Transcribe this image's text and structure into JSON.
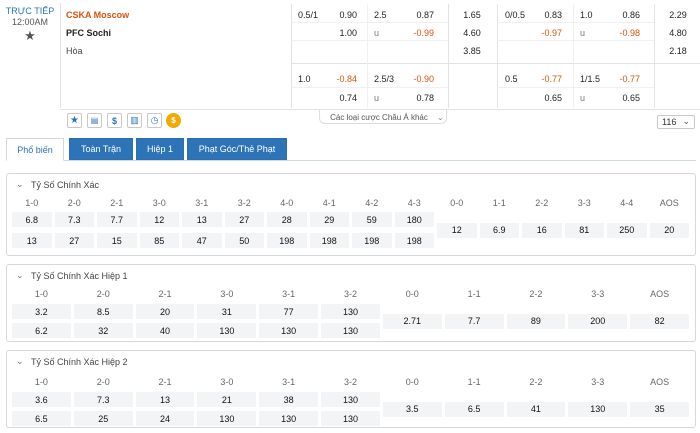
{
  "match": {
    "status": "TRỰC TIẾP",
    "time": "12:00AM",
    "home": "CSKA Moscow",
    "away": "PFC Sochi",
    "draw": "Hòa"
  },
  "odds": {
    "r1": {
      "a1": "0.5/1",
      "a2": "0.90",
      "a3": "2.5",
      "a4": "0.87",
      "a5": "1.65",
      "b1": "0/0.5",
      "b2": "0.83",
      "b3": "1.0",
      "b4": "0.86",
      "b5": "2.29"
    },
    "r2": {
      "a2": "1.00",
      "a3": "u",
      "a4": "-0.99",
      "a5": "4.60",
      "b2": "-0.97",
      "b3": "u",
      "b4": "-0.98",
      "b5": "4.80"
    },
    "r3": {
      "a5": "3.85",
      "b5": "2.18"
    },
    "r4": {
      "a1": "1.0",
      "a2": "-0.84",
      "a3": "2.5/3",
      "a4": "-0.90",
      "b1": "0.5",
      "b2": "-0.77",
      "b3": "1/1.5",
      "b4": "-0.77"
    },
    "r5": {
      "a2": "0.74",
      "a3": "u",
      "a4": "0.78",
      "b2": "0.65",
      "b3": "u",
      "b4": "0.65"
    }
  },
  "toolbar": {
    "asian_more": "Các loại cược Châu Á khác",
    "count": "116"
  },
  "tabs": [
    "Phổ biến",
    "Toàn Trận",
    "Hiệp 1",
    "Phạt Góc/Thẻ Phạt"
  ],
  "sec1": {
    "title": "Tỷ Số Chính Xác",
    "heads": [
      "1-0",
      "2-0",
      "2-1",
      "3-0",
      "3-1",
      "3-2",
      "4-0",
      "4-1",
      "4-2",
      "4-3",
      "0-0",
      "1-1",
      "2-2",
      "3-3",
      "4-4",
      "AOS"
    ],
    "top": [
      "6.8",
      "7.3",
      "7.7",
      "12",
      "13",
      "27",
      "28",
      "29",
      "59",
      "180"
    ],
    "bot": [
      "13",
      "27",
      "15",
      "85",
      "47",
      "50",
      "198",
      "198",
      "198",
      "198"
    ],
    "mid": [
      "12",
      "6.9",
      "16",
      "81",
      "250",
      "20"
    ]
  },
  "sec2": {
    "title": "Tỷ Số Chính Xác Hiệp 1",
    "heads": [
      "1-0",
      "2-0",
      "2-1",
      "3-0",
      "3-1",
      "3-2",
      "0-0",
      "1-1",
      "2-2",
      "3-3",
      "AOS"
    ],
    "top": [
      "3.2",
      "8.5",
      "20",
      "31",
      "77",
      "130"
    ],
    "bot": [
      "6.2",
      "32",
      "40",
      "130",
      "130",
      "130"
    ],
    "mid": [
      "2.71",
      "7.7",
      "89",
      "200",
      "82"
    ]
  },
  "sec3": {
    "title": "Tỷ Số Chính Xác Hiệp 2",
    "heads": [
      "1-0",
      "2-0",
      "2-1",
      "3-0",
      "3-1",
      "3-2",
      "0-0",
      "1-1",
      "2-2",
      "3-3",
      "AOS"
    ],
    "top": [
      "3.6",
      "7.3",
      "13",
      "21",
      "38",
      "130"
    ],
    "bot": [
      "6.5",
      "25",
      "24",
      "130",
      "130",
      "130"
    ],
    "mid": [
      "3.5",
      "6.5",
      "41",
      "130",
      "35"
    ]
  },
  "colors": {
    "accent": "#2c73b8",
    "brand": "#d9540d",
    "negative": "#d9540d"
  }
}
